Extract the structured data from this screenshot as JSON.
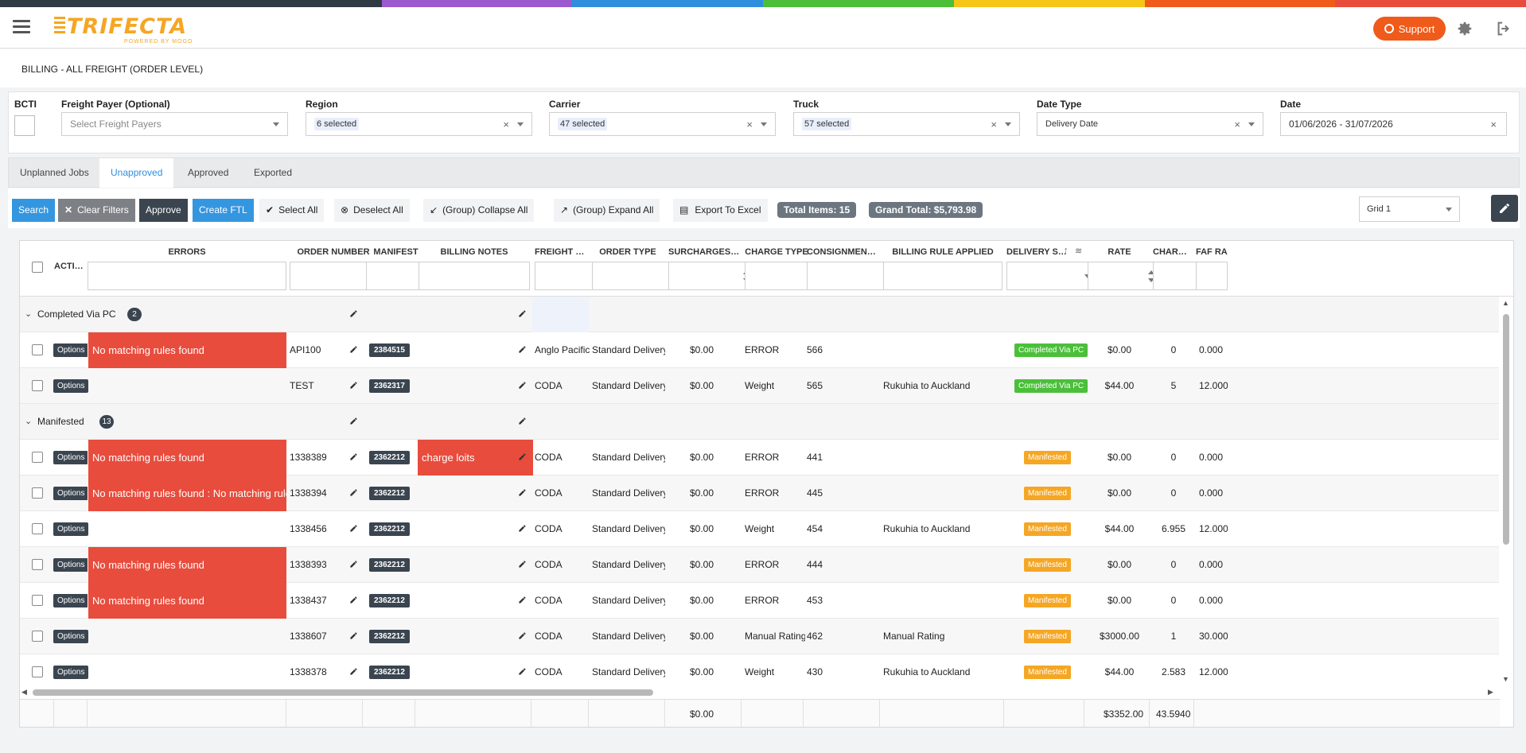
{
  "header": {
    "logo_text": "TRIFECTA",
    "logo_sub": "POWERED BY MOGO",
    "support_label": "Support"
  },
  "page_title": "BILLING - ALL FREIGHT (ORDER LEVEL)",
  "filters": {
    "bcti_label": "BCTI",
    "freight_payer": {
      "label": "Freight Payer (Optional)",
      "placeholder": "Select Freight Payers"
    },
    "region": {
      "label": "Region",
      "value": "6 selected"
    },
    "carrier": {
      "label": "Carrier",
      "value": "47 selected"
    },
    "truck": {
      "label": "Truck",
      "value": "57 selected"
    },
    "date_type": {
      "label": "Date Type",
      "value": "Delivery Date"
    },
    "date": {
      "label": "Date",
      "value": "01/06/2026 - 31/07/2026"
    }
  },
  "tabs": [
    "Unplanned Jobs",
    "Unapproved",
    "Approved",
    "Exported"
  ],
  "toolbar": {
    "search": "Search",
    "clear_filters": "Clear Filters",
    "approve": "Approve",
    "create_ftl": "Create FTL",
    "select_all": "Select All",
    "deselect_all": "Deselect All",
    "collapse_all": "(Group) Collapse All",
    "expand_all": "(Group) Expand All",
    "export": "Export To Excel",
    "total_items": "Total Items: 15",
    "grand_total": "Grand Total: $5,793.98",
    "grid_select": "Grid 1"
  },
  "columns": [
    "ACTION",
    "ERRORS",
    "ORDER NUMBER",
    "MANIFEST",
    "BILLING NOTES",
    "FREIGHT PA...",
    "ORDER TYPE",
    "SURCHARGES TO...",
    "CHARGE TYPE",
    "CONSIGNMENT ...",
    "BILLING RULE APPLIED",
    "DELIVERY ST...",
    "RATE",
    "CHARGE...",
    "FAF RA"
  ],
  "options_label": "Options",
  "groups": [
    {
      "name": "Completed Via PC",
      "count": "2"
    },
    {
      "name": "Manifested",
      "count": "13"
    }
  ],
  "rows": [
    {
      "error": "No matching rules found",
      "order": "API100",
      "manifest": "2384515",
      "notes": "",
      "payer": "Anglo Pacific International",
      "type": "Standard Delivery",
      "sur": "$0.00",
      "charge": "ERROR",
      "cons": "566",
      "rule": "",
      "status": "Completed Via PC",
      "rate": "$0.00",
      "chg": "0",
      "faf": "0.000"
    },
    {
      "error": "",
      "order": "TEST",
      "manifest": "2362317",
      "notes": "",
      "payer": "CODA",
      "type": "Standard Delivery",
      "sur": "$0.00",
      "charge": "Weight",
      "cons": "565",
      "rule": "Rukuhia to Auckland",
      "status": "Completed Via PC",
      "rate": "$44.00",
      "chg": "5",
      "faf": "12.000"
    },
    {
      "error": "No matching rules found",
      "order": "1338389",
      "manifest": "2362212",
      "notes": "charge loits",
      "payer": "CODA",
      "type": "Standard Delivery",
      "sur": "$0.00",
      "charge": "ERROR",
      "cons": "441",
      "rule": "",
      "status": "Manifested",
      "rate": "$0.00",
      "chg": "0",
      "faf": "0.000"
    },
    {
      "error": "No matching rules found : No matching rules found",
      "order": "1338394",
      "manifest": "2362212",
      "notes": "",
      "payer": "CODA",
      "type": "Standard Delivery",
      "sur": "$0.00",
      "charge": "ERROR",
      "cons": "445",
      "rule": "",
      "status": "Manifested",
      "rate": "$0.00",
      "chg": "0",
      "faf": "0.000"
    },
    {
      "error": "",
      "order": "1338456",
      "manifest": "2362212",
      "notes": "",
      "payer": "CODA",
      "type": "Standard Delivery",
      "sur": "$0.00",
      "charge": "Weight",
      "cons": "454",
      "rule": "Rukuhia to Auckland",
      "status": "Manifested",
      "rate": "$44.00",
      "chg": "6.955",
      "faf": "12.000"
    },
    {
      "error": "No matching rules found",
      "order": "1338393",
      "manifest": "2362212",
      "notes": "",
      "payer": "CODA",
      "type": "Standard Delivery",
      "sur": "$0.00",
      "charge": "ERROR",
      "cons": "444",
      "rule": "",
      "status": "Manifested",
      "rate": "$0.00",
      "chg": "0",
      "faf": "0.000"
    },
    {
      "error": "No matching rules found",
      "order": "1338437",
      "manifest": "2362212",
      "notes": "",
      "payer": "CODA",
      "type": "Standard Delivery",
      "sur": "$0.00",
      "charge": "ERROR",
      "cons": "453",
      "rule": "",
      "status": "Manifested",
      "rate": "$0.00",
      "chg": "0",
      "faf": "0.000"
    },
    {
      "error": "",
      "order": "1338607",
      "manifest": "2362212",
      "notes": "",
      "payer": "CODA",
      "type": "Standard Delivery",
      "sur": "$0.00",
      "charge": "Manual Rating",
      "cons": "462",
      "rule": "Manual Rating",
      "status": "Manifested",
      "rate": "$3000.00",
      "chg": "1",
      "faf": "30.000"
    },
    {
      "error": "",
      "order": "1338378",
      "manifest": "2362212",
      "notes": "",
      "payer": "CODA",
      "type": "Standard Delivery",
      "sur": "$0.00",
      "charge": "Weight",
      "cons": "430",
      "rule": "Rukuhia to Auckland",
      "status": "Manifested",
      "rate": "$44.00",
      "chg": "2.583",
      "faf": "12.000"
    }
  ],
  "footer": {
    "sur": "$0.00",
    "rate": "$3352.00",
    "chg": "43.5940"
  },
  "colors": {
    "error": "#e84c3d",
    "primary": "#3596e0",
    "dark": "#3a4550",
    "completed": "#4bbf3a",
    "manifested": "#f5a623",
    "support": "#f05a1a"
  }
}
